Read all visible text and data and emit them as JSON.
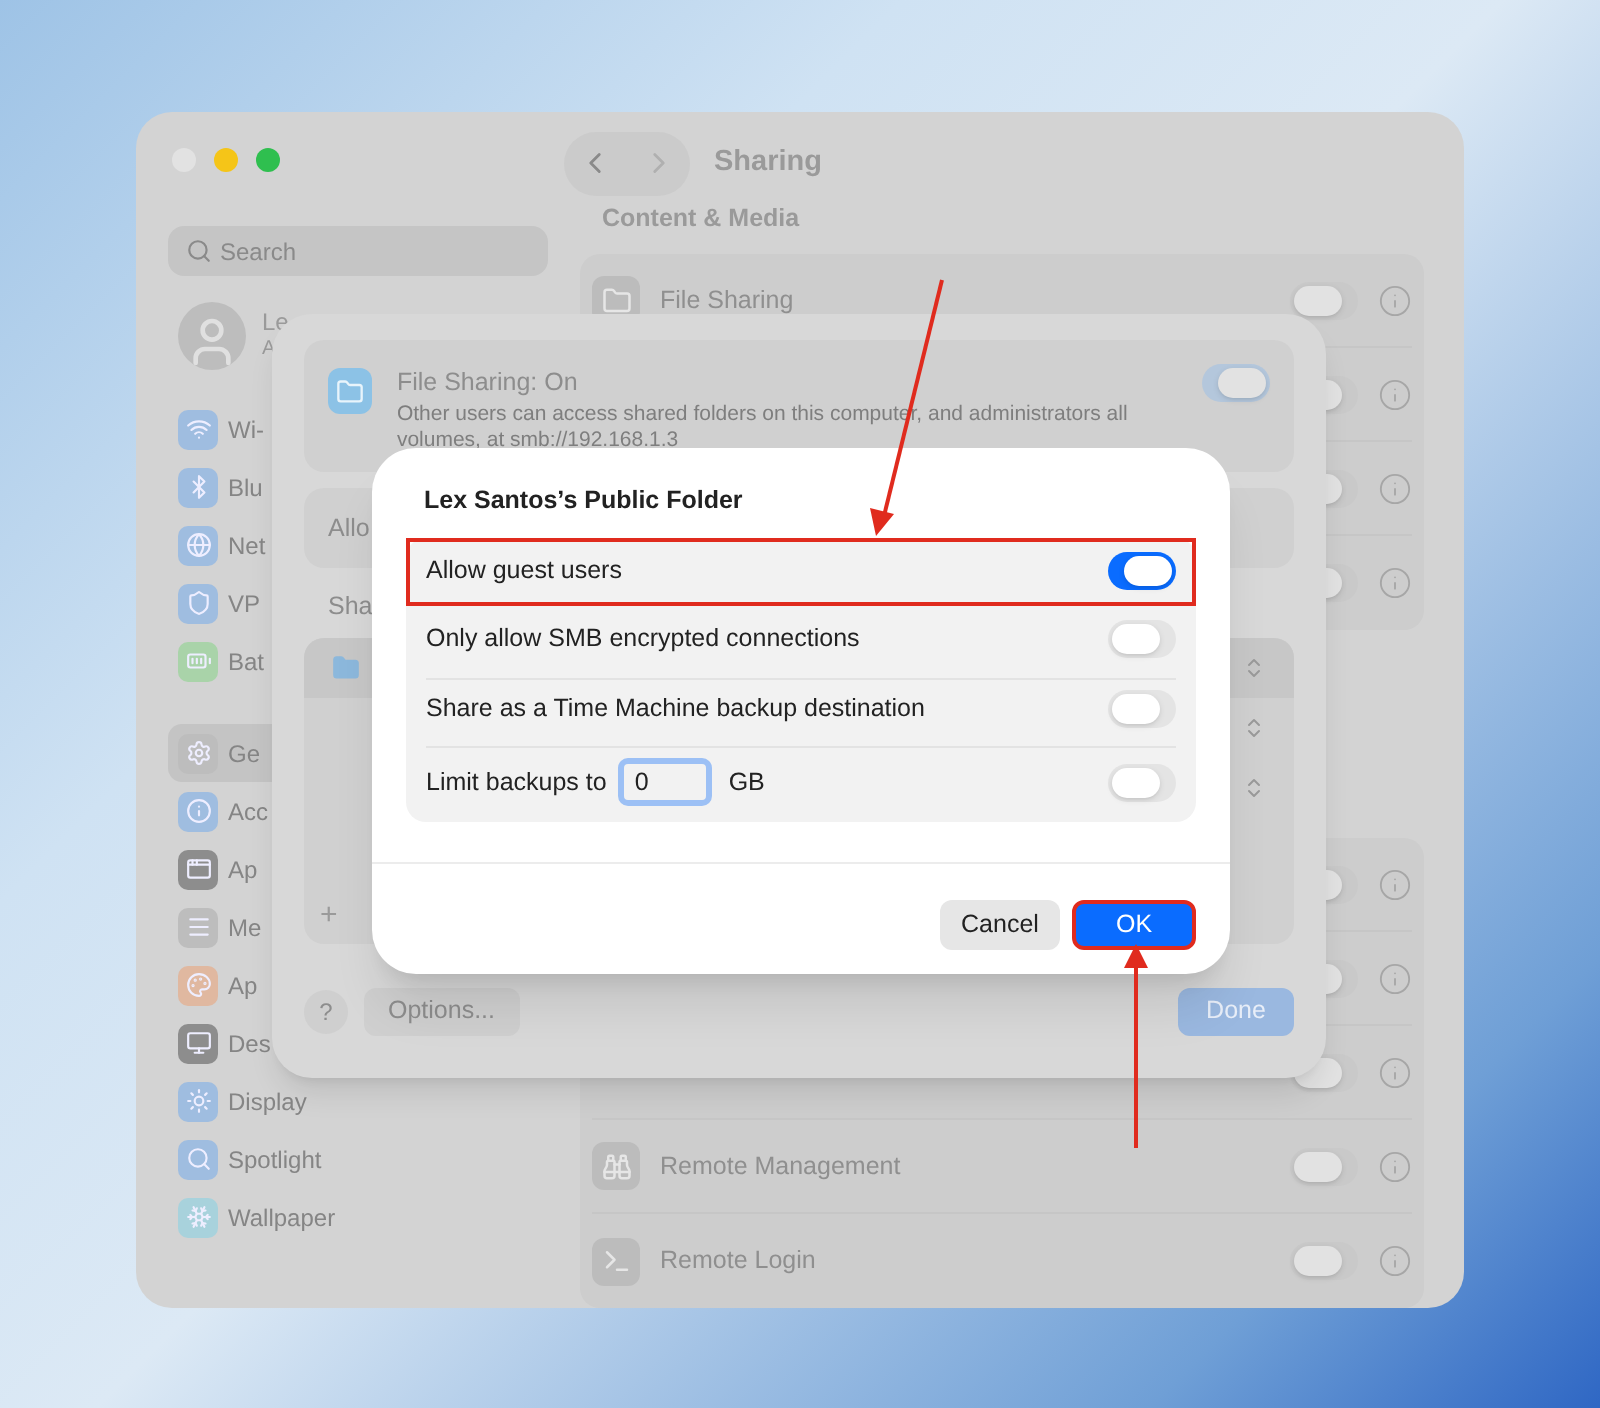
{
  "window": {
    "title": "Sharing"
  },
  "sidebar": {
    "search": {
      "placeholder": "Search"
    },
    "user": {
      "name": "Le",
      "subtitle": "A"
    },
    "groups": [
      [
        {
          "label": "Wi-",
          "selected": false
        },
        {
          "label": "Blu",
          "selected": false
        },
        {
          "label": "Net",
          "selected": false
        },
        {
          "label": "VP",
          "selected": false
        },
        {
          "label": "Bat",
          "selected": false
        }
      ],
      [
        {
          "label": "Ge",
          "selected": true
        },
        {
          "label": "Acc",
          "selected": false
        },
        {
          "label": "Ap",
          "selected": false
        },
        {
          "label": "Me",
          "selected": false
        },
        {
          "label": "Ap",
          "selected": false
        },
        {
          "label": "Des",
          "selected": false
        },
        {
          "label": "Display",
          "selected": false
        },
        {
          "label": "Spotlight",
          "selected": false
        },
        {
          "label": "Wallpaper",
          "selected": false
        }
      ]
    ]
  },
  "content": {
    "sections": [
      {
        "title": "Content & Media",
        "rows": [
          {
            "label": "File Sharing",
            "on": false
          },
          {
            "on": false
          },
          {
            "on": false
          },
          {
            "on": false
          }
        ]
      },
      {
        "rows": [
          {
            "on": false
          },
          {
            "on": false
          },
          {
            "on": false
          },
          {
            "label": "Remote Management",
            "on": false
          },
          {
            "label": "Remote Login",
            "on": false
          }
        ]
      }
    ]
  },
  "sheet": {
    "title": "File Sharing: On",
    "description": "Other users can access shared folders on this computer, and administrators all volumes, at smb://192.168.1.3",
    "on": true,
    "allow_label": "Allo",
    "list_title": "Sha",
    "folders": [
      {
        "selected": true
      },
      {
        "selected": false
      },
      {
        "selected": false
      }
    ],
    "add": "+",
    "help": "?",
    "options": "Options...",
    "done": "Done"
  },
  "dialog": {
    "title": "Lex Santos’s Public Folder",
    "rows": [
      {
        "kind": "toggle",
        "label": "Allow guest users",
        "on": true,
        "highlighted": true
      },
      {
        "kind": "toggle",
        "label": "Only allow SMB encrypted connections",
        "on": false,
        "highlighted": false
      },
      {
        "kind": "toggle",
        "label": "Share as a Time Machine backup destination",
        "on": false,
        "highlighted": false
      },
      {
        "kind": "limit",
        "label": "Limit backups to",
        "value": "0",
        "unit": "GB",
        "on": false,
        "highlighted": false
      }
    ],
    "buttons": [
      {
        "kind": "secondary",
        "label": "Cancel",
        "highlighted": false
      },
      {
        "kind": "primary",
        "label": "OK",
        "highlighted": true
      }
    ]
  }
}
